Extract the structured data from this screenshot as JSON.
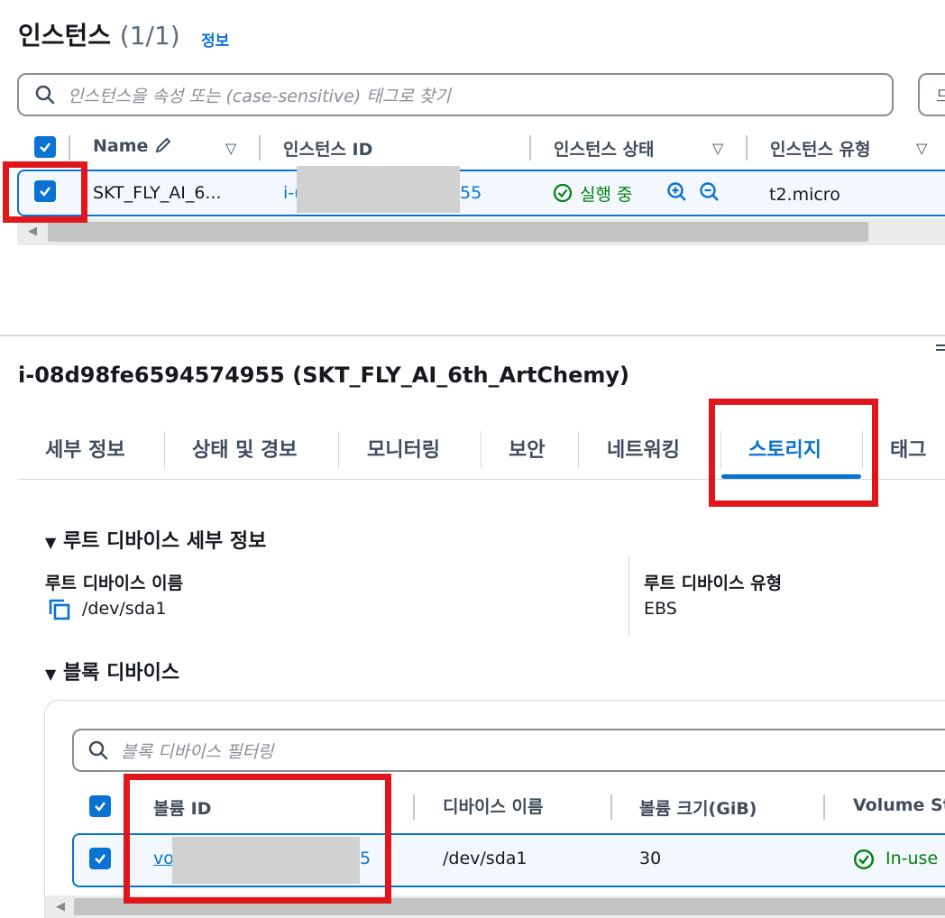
{
  "header": {
    "title": "인스턴스",
    "count": "(1/1)",
    "info_link": "정보"
  },
  "search": {
    "placeholder": "인스턴스을 속성 또는 (case-sensitive) 태그로 찾기",
    "right_button_partial": "드"
  },
  "instances_table": {
    "columns": [
      {
        "label": "Name"
      },
      {
        "label": "인스턴스 ID"
      },
      {
        "label": "인스턴스 상태"
      },
      {
        "label": "인스턴스 유형"
      }
    ],
    "rows": [
      {
        "name": "SKT_FLY_AI_6...",
        "id_prefix": "i-(",
        "id_suffix": "55",
        "state": "실행 중",
        "type": "t2.micro"
      }
    ],
    "scroll_position": 0.0
  },
  "detail": {
    "title": "i-08d98fe6594574955 (SKT_FLY_AI_6th_ArtChemy)",
    "tabs": [
      "세부 정보",
      "상태 및 경보",
      "모니터링",
      "보안",
      "네트워킹",
      "스토리지",
      "태그"
    ],
    "active_tab": "스토리지"
  },
  "root_device": {
    "heading": "루트 디바이스 세부 정보",
    "name_label": "루트 디바이스 이름",
    "name_value": "/dev/sda1",
    "type_label": "루트 디바이스 유형",
    "type_value": "EBS"
  },
  "block_devices": {
    "heading": "블록 디바이스",
    "filter_placeholder": "블록 디바이스 필터링",
    "columns": [
      "볼륨 ID",
      "디바이스 이름",
      "볼륨 크기(GiB)",
      "Volume St"
    ],
    "rows": [
      {
        "volume_id_prefix": "vo",
        "volume_id_suffix": "5",
        "device_name": "/dev/sda1",
        "size": "30",
        "status": "In-use"
      }
    ]
  },
  "colors": {
    "accent": "#0972d3",
    "success": "#037f0c",
    "highlight": "#e0161a"
  }
}
